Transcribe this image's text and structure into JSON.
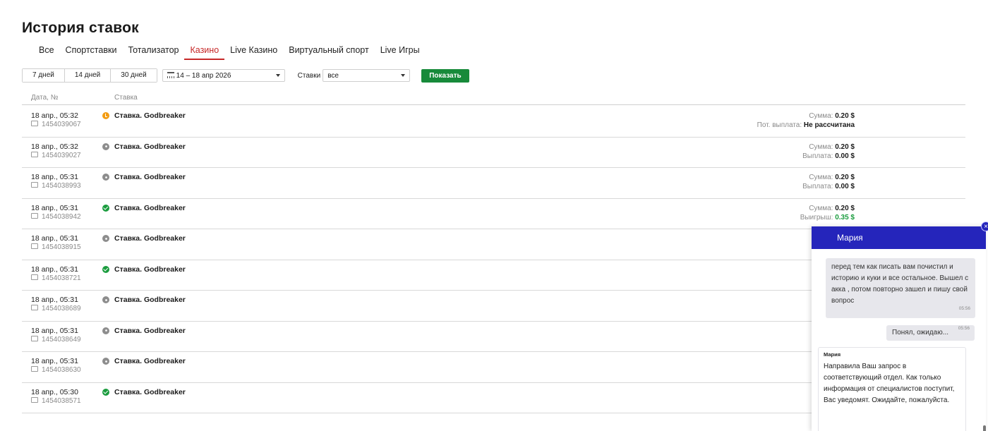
{
  "page": {
    "title": "История ставок"
  },
  "tabs": [
    {
      "label": "Все",
      "active": false
    },
    {
      "label": "Спортставки",
      "active": false
    },
    {
      "label": "Тотализатор",
      "active": false
    },
    {
      "label": "Казино",
      "active": true
    },
    {
      "label": "Live Казино",
      "active": false
    },
    {
      "label": "Виртуальный спорт",
      "active": false
    },
    {
      "label": "Live Игры",
      "active": false
    }
  ],
  "filters": {
    "periods": [
      "7 дней",
      "14 дней",
      "30 дней"
    ],
    "date_range": "14 – 18 апр 2026",
    "bets_label": "Ставки",
    "bets_value": "все",
    "show_button": "Показать"
  },
  "columns": {
    "date": "Дата, №",
    "bet": "Ставка"
  },
  "bets": [
    {
      "date": "18 апр., 05:32",
      "id": "1454039067",
      "status": "pending",
      "title": "Ставка. Godbreaker",
      "sum_label": "Сумма:",
      "sum": "0.20 $",
      "result_label": "Пот. выплата:",
      "result": "Не рассчитана"
    },
    {
      "date": "18 апр., 05:32",
      "id": "1454039027",
      "status": "lost",
      "title": "Ставка. Godbreaker",
      "sum_label": "Сумма:",
      "sum": "0.20 $",
      "result_label": "Выплата:",
      "result": "0.00 $"
    },
    {
      "date": "18 апр., 05:31",
      "id": "1454038993",
      "status": "lost",
      "title": "Ставка. Godbreaker",
      "sum_label": "Сумма:",
      "sum": "0.20 $",
      "result_label": "Выплата:",
      "result": "0.00 $"
    },
    {
      "date": "18 апр., 05:31",
      "id": "1454038942",
      "status": "won",
      "title": "Ставка. Godbreaker",
      "sum_label": "Сумма:",
      "sum": "0.20 $",
      "result_label": "Выигрыш:",
      "result": "0.35 $"
    },
    {
      "date": "18 апр., 05:31",
      "id": "1454038915",
      "status": "lost",
      "title": "Ставка. Godbreaker",
      "sum_label": "",
      "sum": "",
      "result_label": "",
      "result": ""
    },
    {
      "date": "18 апр., 05:31",
      "id": "1454038721",
      "status": "won",
      "title": "Ставка. Godbreaker",
      "sum_label": "",
      "sum": "",
      "result_label": "",
      "result": ""
    },
    {
      "date": "18 апр., 05:31",
      "id": "1454038689",
      "status": "lost",
      "title": "Ставка. Godbreaker",
      "sum_label": "",
      "sum": "",
      "result_label": "",
      "result": ""
    },
    {
      "date": "18 апр., 05:31",
      "id": "1454038649",
      "status": "lost",
      "title": "Ставка. Godbreaker",
      "sum_label": "",
      "sum": "",
      "result_label": "",
      "result": ""
    },
    {
      "date": "18 апр., 05:31",
      "id": "1454038630",
      "status": "lost",
      "title": "Ставка. Godbreaker",
      "sum_label": "",
      "sum": "",
      "result_label": "",
      "result": ""
    },
    {
      "date": "18 апр., 05:30",
      "id": "1454038571",
      "status": "won",
      "title": "Ставка. Godbreaker",
      "sum_label": "",
      "sum": "",
      "result_label": "",
      "result": ""
    }
  ],
  "chat": {
    "agent_name": "Мария",
    "close_glyph": "×",
    "messages": {
      "user_1": "перед тем как писать вам почистил и историю и куки и все остальное. Вышел с акка , потом повторно зашел и пишу свой вопрос",
      "user_1_time": "05:56",
      "user_2": "Понял, ожидаю...",
      "user_2_time": "05:56",
      "agent_author": "Мария",
      "agent_text": "Направила Ваш запрос в соответствующий отдел. Как только информация от специалистов поступит, Вас уведомят. Ожидайте, пожалуйста."
    }
  },
  "colors": {
    "accent_red": "#c62828",
    "green": "#178a3a",
    "chat_blue": "#2525bb",
    "pending": "#f39c12"
  }
}
